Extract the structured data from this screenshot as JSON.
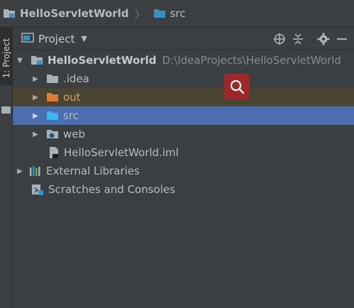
{
  "breadcrumb": {
    "project": "HelloServletWorld",
    "folder": "src"
  },
  "stripe": {
    "label": "1: Project"
  },
  "toolwindow": {
    "title": "Project",
    "icons": [
      "locate-icon",
      "collapse-all-icon",
      "gear-icon",
      "hide-icon"
    ]
  },
  "tree": {
    "root_label": "HelloServletWorld",
    "root_path": "D:\\IdeaProjects\\HelloServletWorld",
    "items": [
      {
        "label": ".idea",
        "icon": "folder-icon"
      },
      {
        "label": "out",
        "icon": "excluded-folder-icon"
      },
      {
        "label": "src",
        "icon": "source-folder-icon",
        "selected": true
      },
      {
        "label": "web",
        "icon": "web-folder-icon"
      },
      {
        "label": "HelloServletWorld.iml",
        "icon": "module-file-icon"
      }
    ],
    "external_libraries": "External Libraries",
    "scratches": "Scratches and Consoles"
  },
  "colors": {
    "background": "#3c3f41",
    "selection": "#4b6eaf",
    "excluded_row": "#4a4433",
    "search_badge": "#9e2727",
    "source_folder": "#3592c4",
    "excluded_folder": "#e07c30"
  }
}
